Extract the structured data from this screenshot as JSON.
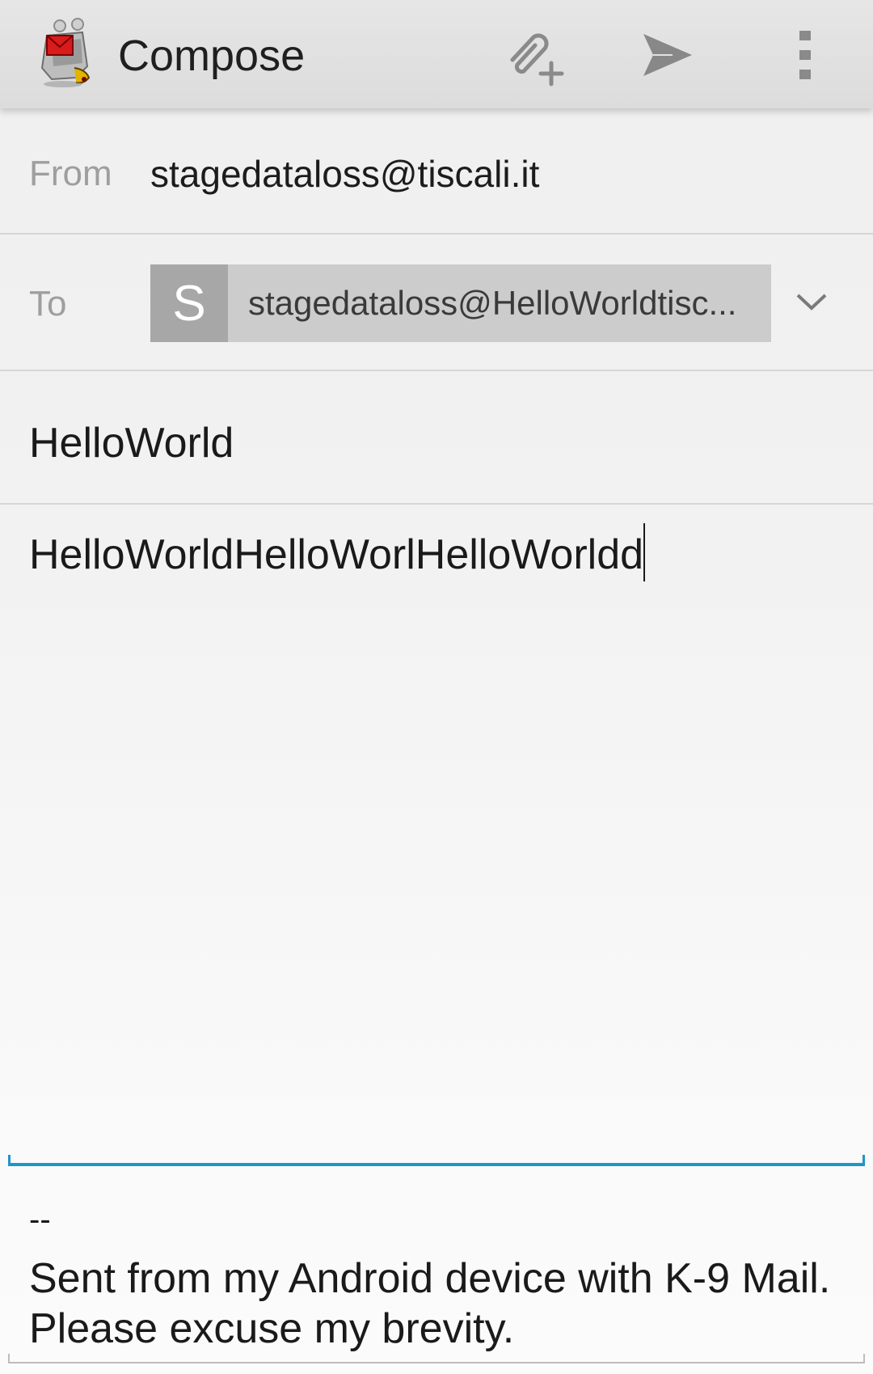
{
  "action_bar": {
    "title": "Compose",
    "icons": {
      "app": "k9-dog-mail-icon",
      "attach": "attach-file-icon",
      "send": "send-icon",
      "overflow": "more-vert-icon"
    }
  },
  "from": {
    "label": "From",
    "value": "stagedataloss@tiscali.it"
  },
  "to": {
    "label": "To",
    "recipient": {
      "initial": "S",
      "address": "stagedataloss@HelloWorldtisc..."
    },
    "expand_icon": "chevron-down-icon"
  },
  "subject": {
    "value": "HelloWorld"
  },
  "body": {
    "value": "HelloWorldHelloWorlHelloWorldd"
  },
  "signature": {
    "separator": "--",
    "text": "Sent from my Android device with K-9 Mail. Please excuse my brevity."
  },
  "colors": {
    "focus_accent": "#1e96c8",
    "chip_background": "#cccccc",
    "chip_avatar": "#a7a7a7",
    "icon_gray": "#8a8a8a"
  }
}
